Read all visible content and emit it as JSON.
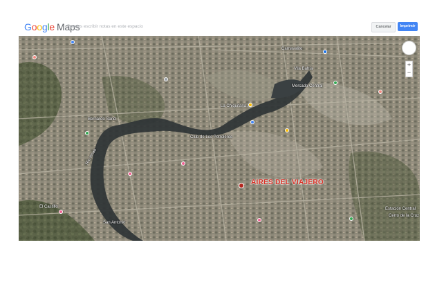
{
  "header": {
    "logo_google": "Google",
    "logo_maps": "Maps",
    "note": "Puedes escribir notas en este espacio",
    "cancel_label": "Cancelar",
    "print_label": "Imprimir"
  },
  "colors": {
    "accent": "#4285f4",
    "marker": "#d93025"
  },
  "map": {
    "featured_place": "AIRES DEL VIAJERO",
    "labels": [
      "La Chiquitana",
      "Bernardo Sand",
      "Club de Los Petroleros",
      "Estación Central",
      "Cerro de la Cruz",
      "Vila Bahía",
      "San Antonio",
      "Río Itinao",
      "Carnavalito",
      "Mercado Central",
      "El Castillo"
    ],
    "controls": {
      "zoom_in": "+",
      "zoom_out": "−"
    }
  }
}
